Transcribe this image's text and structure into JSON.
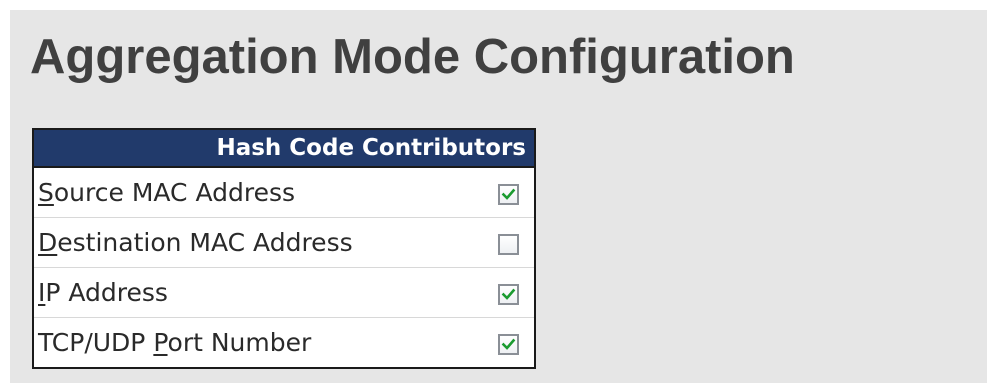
{
  "page": {
    "title": "Aggregation Mode Configuration"
  },
  "hash_table": {
    "header": "Hash Code Contributors",
    "rows": [
      {
        "accel": "S",
        "rest": "ource MAC Address",
        "prefix": "",
        "checked": true,
        "check_icon": "checkmark-icon"
      },
      {
        "accel": "D",
        "rest": "estination MAC Address",
        "prefix": "",
        "checked": false,
        "check_icon": "checkmark-icon"
      },
      {
        "accel": "I",
        "rest": "P Address",
        "prefix": "",
        "checked": true,
        "check_icon": "checkmark-icon"
      },
      {
        "prefix": "TCP/UDP ",
        "accel": "P",
        "rest": "ort Number",
        "checked": true,
        "check_icon": "checkmark-icon"
      }
    ]
  },
  "colors": {
    "header_bg": "#213a6b",
    "check_color": "#1a9b2f",
    "panel_bg": "#e6e6e6",
    "title_color": "#404040"
  }
}
